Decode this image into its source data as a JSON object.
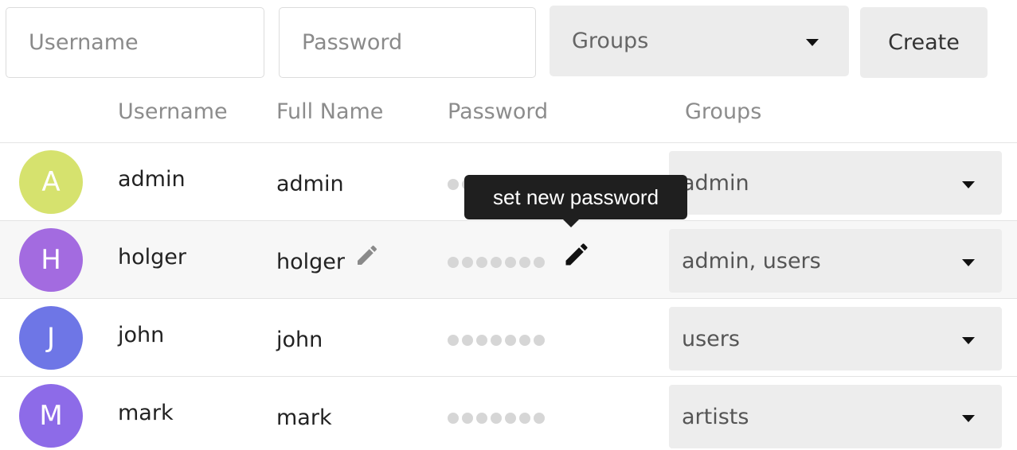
{
  "form": {
    "username_placeholder": "Username",
    "password_placeholder": "Password",
    "groups_placeholder": "Groups",
    "create_label": "Create"
  },
  "table": {
    "headers": [
      "Username",
      "Full Name",
      "Password",
      "Groups"
    ],
    "rows": [
      {
        "initial": "A",
        "username": "admin",
        "fullname": "admin",
        "groups": "admin",
        "avatar_color": "#d6e26e"
      },
      {
        "initial": "H",
        "username": "holger",
        "fullname": "holger",
        "groups": "admin, users",
        "avatar_color": "#a36be0"
      },
      {
        "initial": "J",
        "username": "john",
        "fullname": "john",
        "groups": "users",
        "avatar_color": "#6e76e6"
      },
      {
        "initial": "M",
        "username": "mark",
        "fullname": "mark",
        "groups": "artists",
        "avatar_color": "#8d6be8"
      }
    ]
  },
  "tooltip": {
    "text": "set new password"
  },
  "icons": {
    "fullname_edit": "pencil-icon",
    "password_edit": "pencil-icon"
  }
}
